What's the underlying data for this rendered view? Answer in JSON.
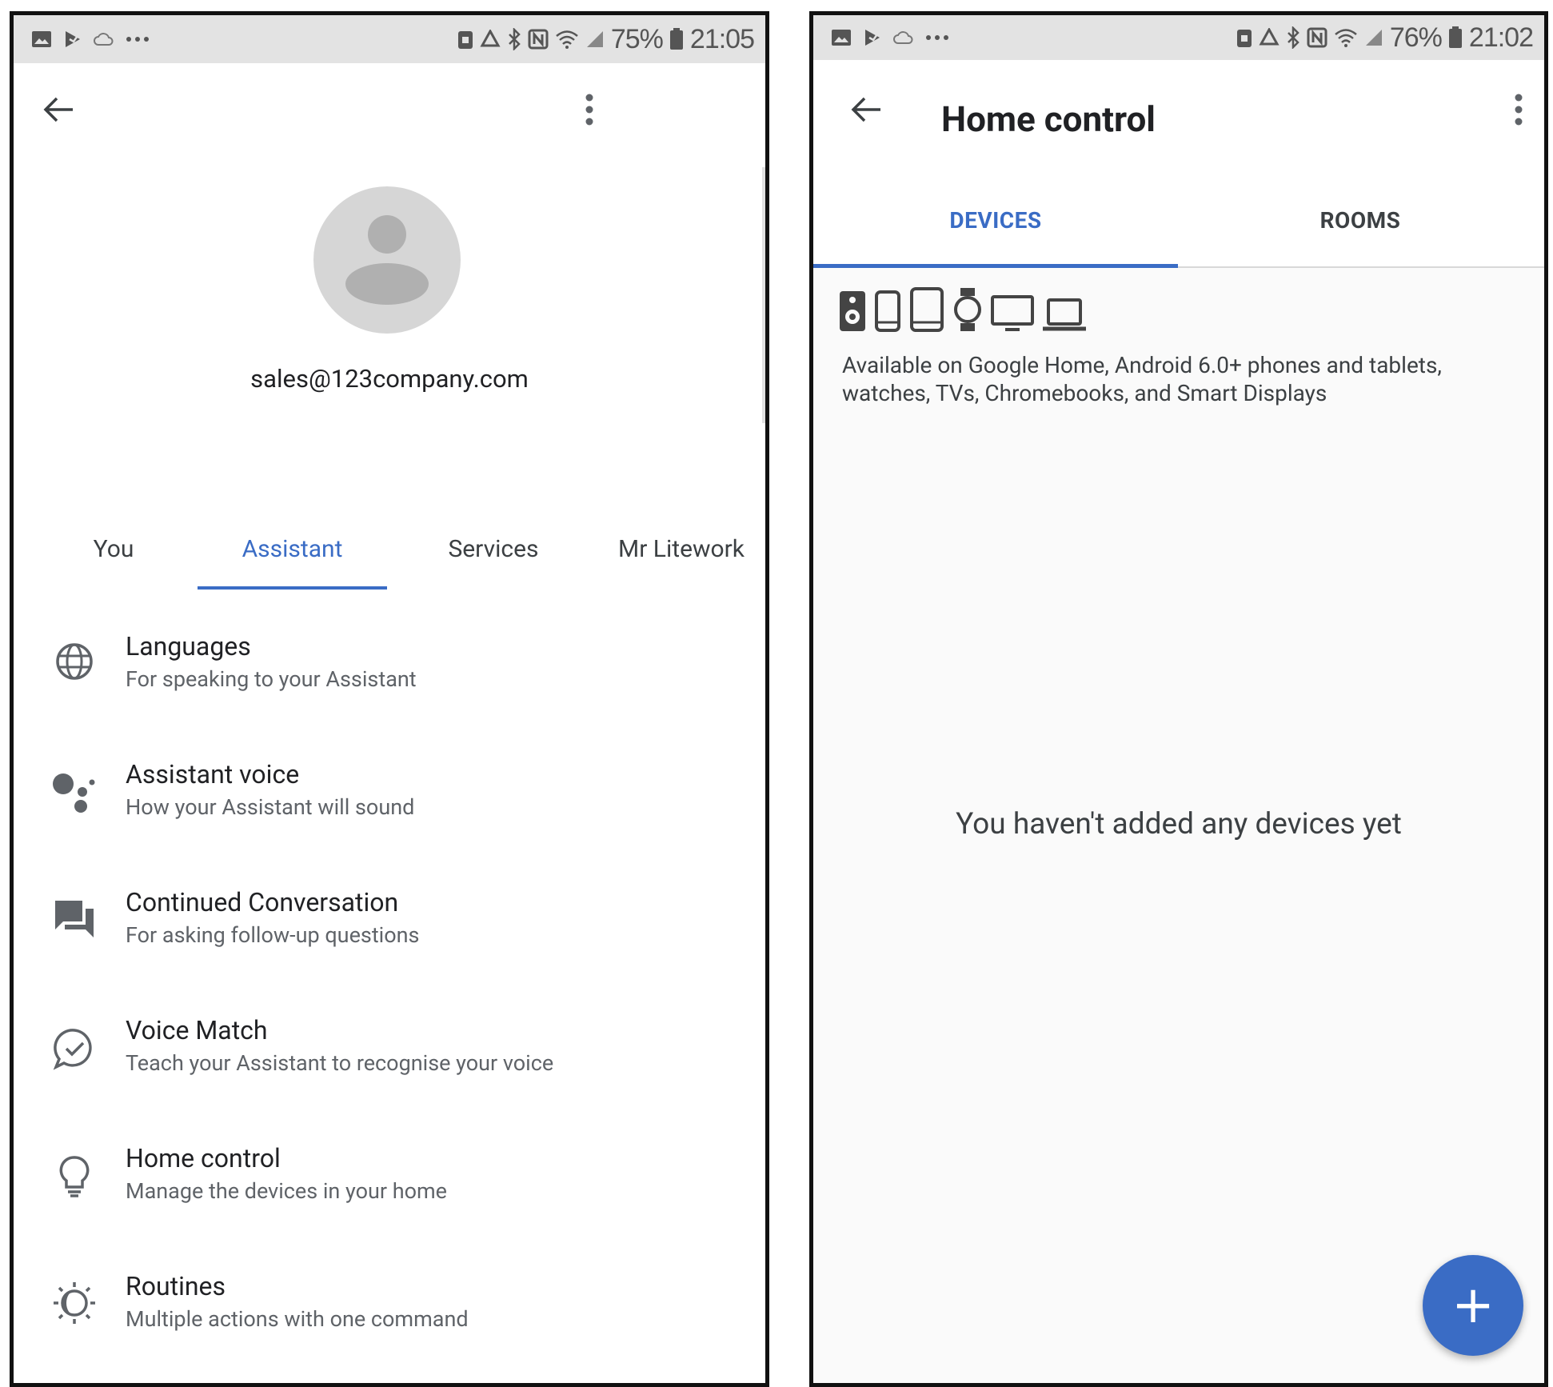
{
  "left_phone": {
    "status_bar": {
      "battery": "75%",
      "time": "21:05"
    },
    "profile": {
      "email": "sales@123company.com"
    },
    "tabs": [
      {
        "label": "You",
        "active": false
      },
      {
        "label": "Assistant",
        "active": true
      },
      {
        "label": "Services",
        "active": false
      },
      {
        "label": "Mr Litework",
        "active": false
      }
    ],
    "menu": [
      {
        "icon": "globe-icon",
        "title": "Languages",
        "subtitle": "For speaking to your Assistant"
      },
      {
        "icon": "assistant-dots-icon",
        "title": "Assistant voice",
        "subtitle": "How your Assistant will sound"
      },
      {
        "icon": "chat-bubbles-icon",
        "title": "Continued Conversation",
        "subtitle": "For asking follow-up questions"
      },
      {
        "icon": "voice-match-icon",
        "title": "Voice Match",
        "subtitle": "Teach your Assistant to recognise your voice"
      },
      {
        "icon": "lightbulb-icon",
        "title": "Home control",
        "subtitle": "Manage the devices in your home"
      },
      {
        "icon": "routines-sun-icon",
        "title": "Routines",
        "subtitle": "Multiple actions with one command"
      }
    ]
  },
  "right_phone": {
    "status_bar": {
      "battery": "76%",
      "time": "21:02"
    },
    "header": {
      "title": "Home control"
    },
    "tabs": [
      {
        "label": "DEVICES",
        "active": true
      },
      {
        "label": "ROOMS",
        "active": false
      }
    ],
    "device_types": [
      "speaker-icon",
      "phone-icon",
      "tablet-icon",
      "watch-icon",
      "tv-icon",
      "laptop-icon"
    ],
    "availability_text": "Available on Google Home, Android 6.0+ phones and tablets, watches, TVs, Chromebooks, and Smart Displays",
    "empty_message": "You haven't added any devices yet",
    "fab": {
      "label": "+"
    }
  },
  "colors": {
    "accent": "#3a6cc5",
    "status_bar": "#e3e3e3",
    "avatar": "#d6d6d6"
  }
}
